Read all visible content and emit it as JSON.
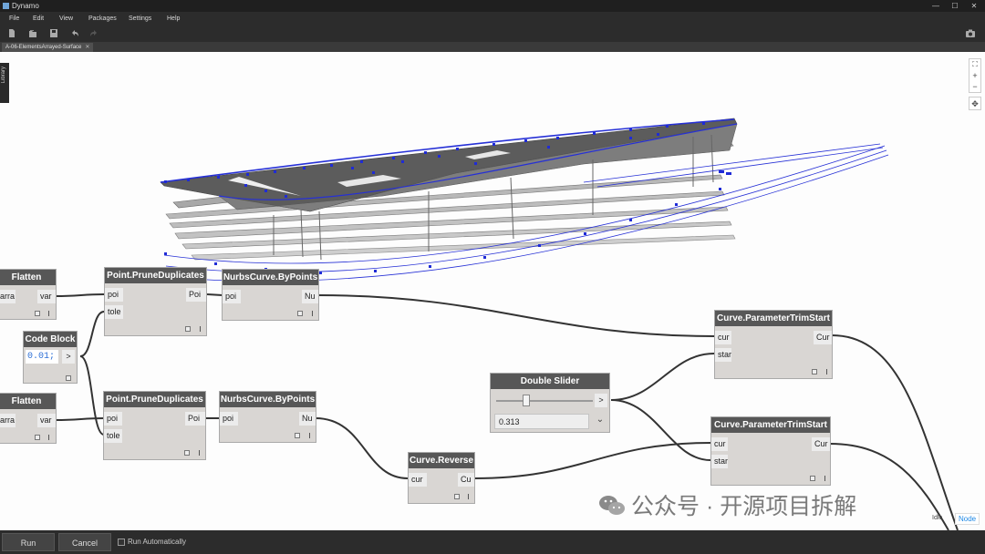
{
  "window": {
    "title": "Dynamo",
    "minimize": "—",
    "maximize": "☐",
    "close": "✕"
  },
  "menu": [
    "File",
    "Edit",
    "View",
    "Packages",
    "Settings",
    "Help"
  ],
  "toolbar": {
    "icons": [
      "new-file-icon",
      "open-file-icon",
      "save-icon",
      "undo-icon",
      "redo-icon"
    ],
    "screenshot_icon": "camera-icon"
  },
  "tab": {
    "label": "A-06-ElementsArrayed-Surface",
    "close": "✕"
  },
  "library": {
    "label": "Library"
  },
  "zoom": {
    "fit": "⛶",
    "in": "+",
    "out": "−",
    "pan": "✥"
  },
  "nodes": {
    "flatten1": {
      "title": "Flatten",
      "in": "arra",
      "out": "var"
    },
    "flatten2": {
      "title": "Flatten",
      "in": "arra",
      "out": "var"
    },
    "codeblock": {
      "title": "Code Block",
      "code": "0.01;",
      "out": ">"
    },
    "prune1": {
      "title": "Point.PruneDuplicates",
      "in1": "poi",
      "in2": "tole",
      "out": "Poi"
    },
    "prune2": {
      "title": "Point.PruneDuplicates",
      "in1": "poi",
      "in2": "tole",
      "out": "Poi"
    },
    "nurbs1": {
      "title": "NurbsCurve.ByPoints",
      "in": "poi",
      "out": "Nu"
    },
    "nurbs2": {
      "title": "NurbsCurve.ByPoints",
      "in": "poi",
      "out": "Nu"
    },
    "reverse": {
      "title": "Curve.Reverse",
      "in": "cur",
      "out": "Cu"
    },
    "slider": {
      "title": "Double Slider",
      "value": "0.313",
      "out": ">",
      "expand": "⌄",
      "level": 0.313
    },
    "trim1": {
      "title": "Curve.ParameterTrimStart",
      "in1": "cur",
      "in2": "star",
      "out": "Cur"
    },
    "trim2": {
      "title": "Curve.ParameterTrimStart",
      "in1": "cur",
      "in2": "star",
      "out": "Cur"
    }
  },
  "bottom": {
    "run": "Run",
    "cancel": "Cancel",
    "run_auto": "Run Automatically",
    "run_auto_checked": false
  },
  "watermark": "公众号 · 开源项目拆解",
  "overlay": {
    "state": "Idle",
    "node": "Node"
  },
  "colors": {
    "accent": "#1f2bd6",
    "node_header": "#575757",
    "node_body": "#d9d6d3",
    "chrome": "#2c2c2c"
  }
}
